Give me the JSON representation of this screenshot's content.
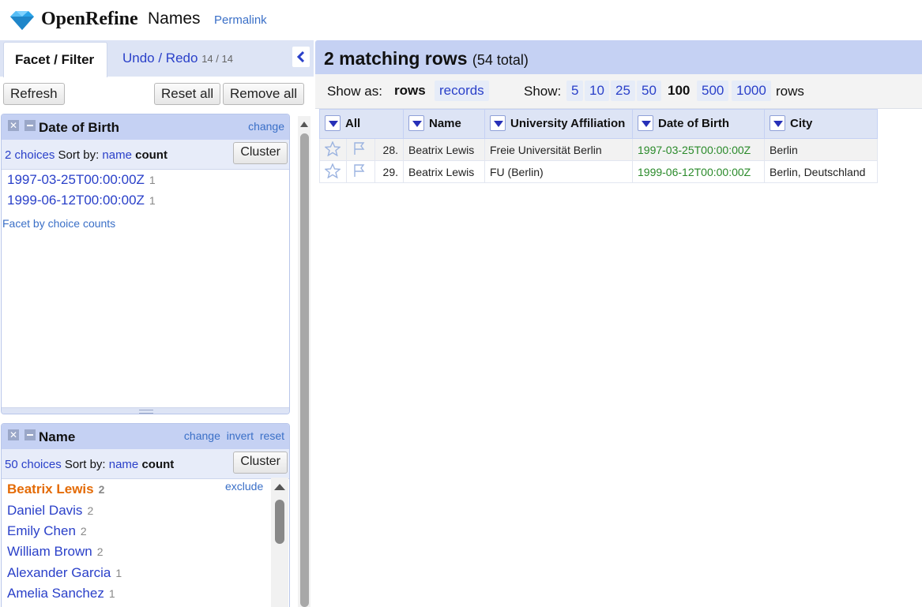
{
  "header": {
    "app_name": "OpenRefine",
    "project_name": "Names",
    "permalink": "Permalink"
  },
  "left": {
    "tab_facet": "Facet / Filter",
    "tab_undo": "Undo / Redo",
    "undo_count": "14 / 14",
    "refresh": "Refresh",
    "reset_all": "Reset all",
    "remove_all": "Remove all",
    "facets": [
      {
        "title": "Date of Birth",
        "link_change": "change",
        "choices_count": "2 choices",
        "sort_by": "Sort by:",
        "sort_name": "name",
        "sort_count": "count",
        "cluster": "Cluster",
        "choices": [
          {
            "label": "1997-03-25T00:00:00Z",
            "count": "1"
          },
          {
            "label": "1999-06-12T00:00:00Z",
            "count": "1"
          }
        ],
        "footer": "Facet by choice counts"
      },
      {
        "title": "Name",
        "link_change": "change",
        "link_invert": "invert",
        "link_reset": "reset",
        "choices_count": "50 choices",
        "sort_by": "Sort by:",
        "sort_name": "name",
        "sort_count": "count",
        "cluster": "Cluster",
        "exclude": "exclude",
        "choices": [
          {
            "label": "Beatrix Lewis",
            "count": "2"
          },
          {
            "label": "Daniel Davis",
            "count": "2"
          },
          {
            "label": "Emily Chen",
            "count": "2"
          },
          {
            "label": "William Brown",
            "count": "2"
          },
          {
            "label": "Alexander Garcia",
            "count": "1"
          },
          {
            "label": "Amelia Sanchez",
            "count": "1"
          }
        ]
      }
    ]
  },
  "right": {
    "matching": "2 matching rows",
    "total": "(54 total)",
    "show_as": "Show as:",
    "mode_rows": "rows",
    "mode_records": "records",
    "show": "Show:",
    "page_sizes": [
      "5",
      "10",
      "25",
      "50",
      "100",
      "500",
      "1000"
    ],
    "rows_suffix": "rows",
    "columns": [
      "All",
      "Name",
      "University Affiliation",
      "Date of Birth",
      "City"
    ],
    "rows": [
      {
        "num": "28.",
        "name": "Beatrix Lewis",
        "affiliation": "Freie Universität Berlin",
        "dob": "1997-03-25T00:00:00Z",
        "city": "Berlin"
      },
      {
        "num": "29.",
        "name": "Beatrix Lewis",
        "affiliation": "FU (Berlin)",
        "dob": "1999-06-12T00:00:00Z",
        "city": "Berlin, Deutschland"
      }
    ]
  },
  "colors": {
    "accent": "#c5d1f3",
    "link": "#2a40c9",
    "selected": "#e46b06",
    "date": "#2a8a2a"
  }
}
